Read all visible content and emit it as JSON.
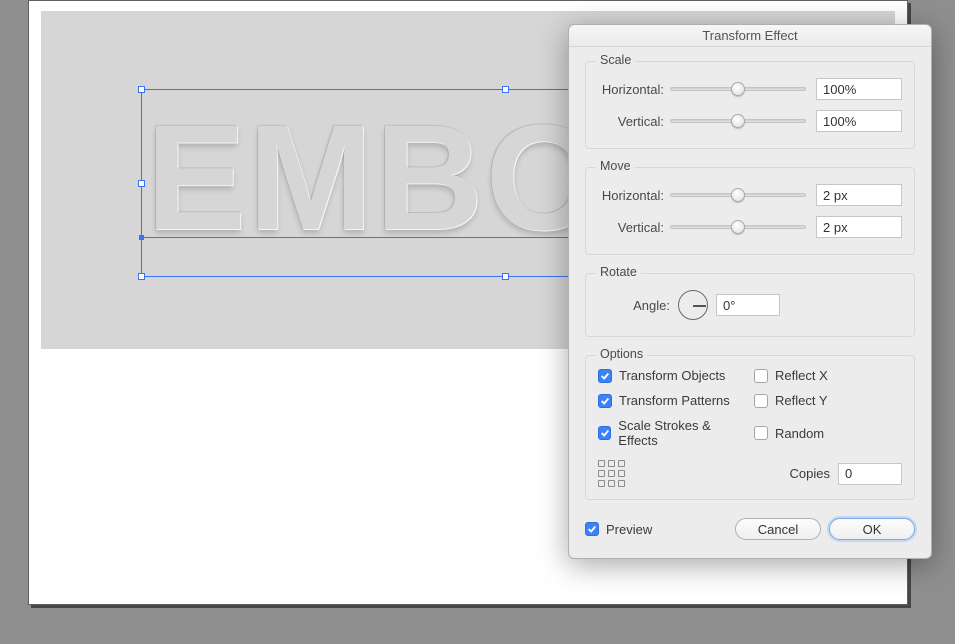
{
  "canvas": {
    "text": "EMBOSS"
  },
  "dialog": {
    "title": "Transform Effect",
    "scale": {
      "legend": "Scale",
      "horizontal_label": "Horizontal:",
      "horizontal_value": "100%",
      "vertical_label": "Vertical:",
      "vertical_value": "100%"
    },
    "move": {
      "legend": "Move",
      "horizontal_label": "Horizontal:",
      "horizontal_value": "2 px",
      "vertical_label": "Vertical:",
      "vertical_value": "2 px"
    },
    "rotate": {
      "legend": "Rotate",
      "angle_label": "Angle:",
      "angle_value": "0°"
    },
    "options": {
      "legend": "Options",
      "transform_objects": "Transform Objects",
      "transform_patterns": "Transform Patterns",
      "scale_strokes": "Scale Strokes & Effects",
      "reflect_x": "Reflect X",
      "reflect_y": "Reflect Y",
      "random": "Random",
      "copies_label": "Copies",
      "copies_value": "0"
    },
    "footer": {
      "preview": "Preview",
      "cancel": "Cancel",
      "ok": "OK"
    }
  }
}
